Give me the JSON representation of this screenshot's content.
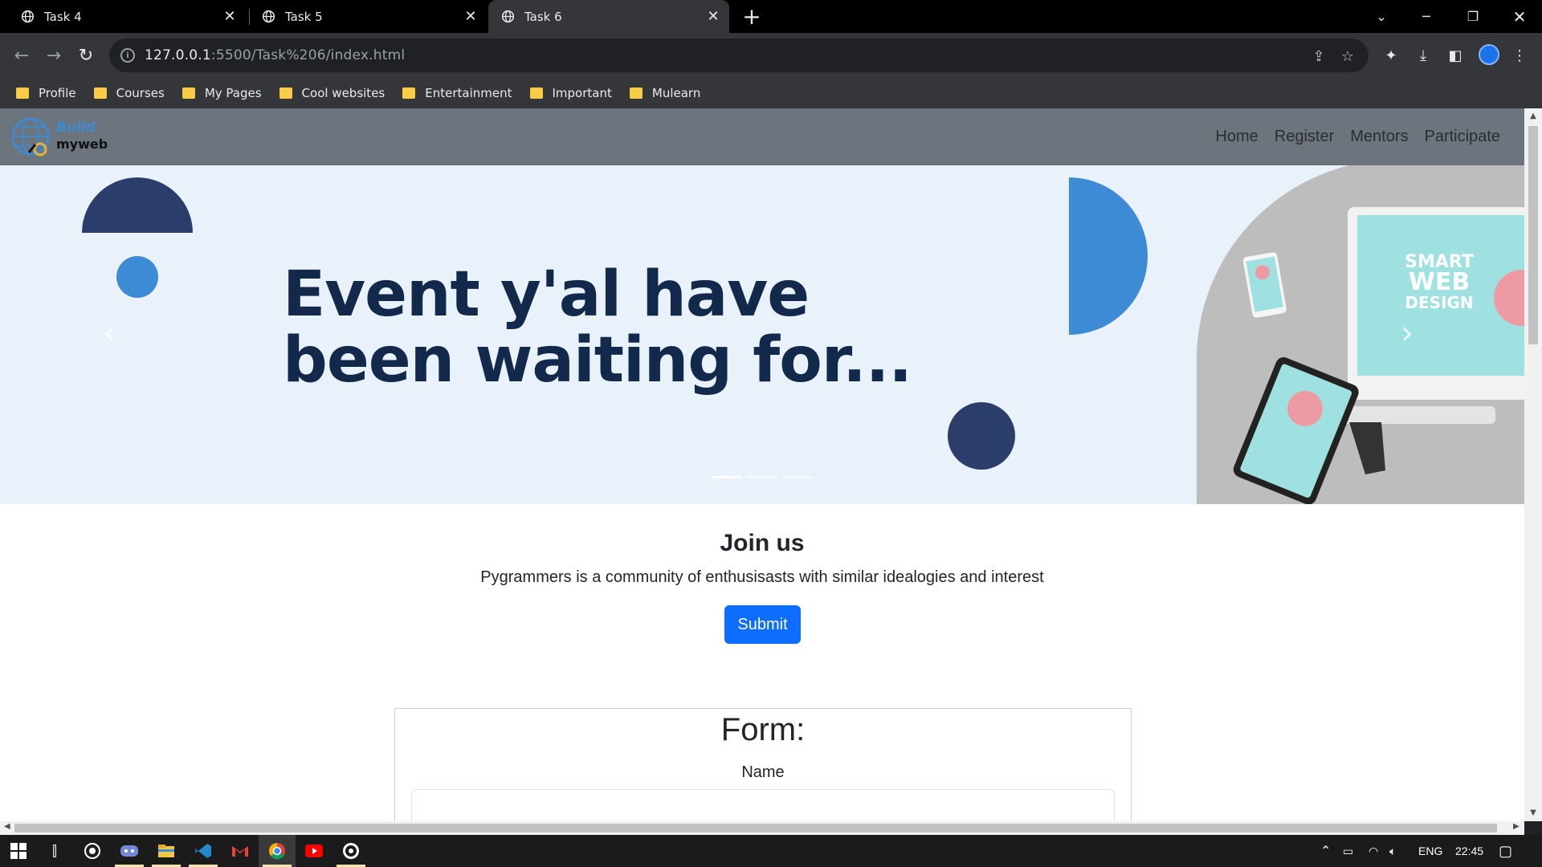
{
  "browser": {
    "tabs": [
      {
        "title": "Task 4",
        "active": false
      },
      {
        "title": "Task 5",
        "active": false
      },
      {
        "title": "Task 6",
        "active": true
      }
    ],
    "url_host": "127.0.0.1",
    "url_rest": ":5500/Task%206/index.html",
    "bookmarks": [
      "Profile",
      "Courses",
      "My Pages",
      "Cool websites",
      "Entertainment",
      "Important",
      "Mulearn"
    ]
  },
  "site": {
    "logo_line1": "Build",
    "logo_line2": "myweb",
    "nav": [
      "Home",
      "Register",
      "Mentors",
      "Participate"
    ],
    "hero_text": "Event y'al have\nbeen waiting for...",
    "hero_image_text": [
      "SMART",
      "WEB",
      "DESIGN"
    ],
    "join_title": "Join us",
    "join_description": "Pygrammers is a community of enthusisasts with similar idealogies and interest",
    "submit_label": "Submit",
    "form_title": "Form:",
    "form_name_label": "Name"
  },
  "taskbar": {
    "language": "ENG",
    "time": "22:45"
  },
  "colors": {
    "nav_bg": "#6c757d",
    "hero_bg": "#e9f1fa",
    "hero_text": "#13294b",
    "accent_blue": "#3d8bd5",
    "dark_navy": "#2b3e6b",
    "submit": "#0d6efd"
  }
}
